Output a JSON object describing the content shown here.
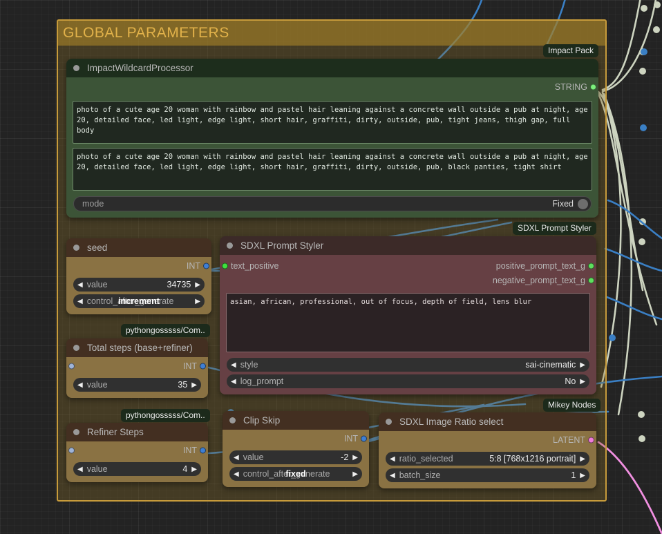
{
  "group": {
    "title": "GLOBAL PARAMETERS",
    "border_color": "#c79b3b",
    "title_color": "#e2b24a"
  },
  "badges": {
    "impact_pack": "Impact Pack",
    "sdxl_prompt_styler": "SDXL Prompt Styler",
    "pythongosssss_1": "pythongosssss/Com..",
    "pythongosssss_2": "pythongosssss/Com..",
    "mikey_nodes": "Mikey Nodes"
  },
  "nodes": {
    "wildcard": {
      "title": "ImpactWildcardProcessor",
      "output_label": "STRING",
      "output_color": "#7cf07c",
      "textarea_1": "photo of a cute age 20 woman with rainbow and pastel hair leaning against a concrete wall outside a pub at night, age 20, detailed face, led light, edge light, short hair, graffiti, dirty, outside, pub, tight jeans, thigh gap, full body",
      "textarea_2": "photo of a cute age 20 woman with rainbow and pastel hair leaning against a concrete wall outside a pub at night, age 20, detailed face, led light, edge light, short hair, graffiti, dirty, outside, pub, black panties, tight shirt",
      "mode_label": "mode",
      "mode_value": "Fixed"
    },
    "seed": {
      "title": "seed",
      "output_label": "INT",
      "output_color": "#3f7fd4",
      "widgets": [
        {
          "label": "value",
          "value": "34735",
          "overlap": false
        },
        {
          "label": "control_after_generate",
          "value": "increment",
          "overlap": true
        }
      ]
    },
    "total_steps": {
      "title": "Total steps (base+refiner)",
      "output_label": "INT",
      "output_color": "#3f7fd4",
      "input_color": "#9fb4d8",
      "widgets": [
        {
          "label": "value",
          "value": "35",
          "overlap": false
        }
      ]
    },
    "refiner_steps": {
      "title": "Refiner Steps",
      "output_label": "INT",
      "output_color": "#3f7fd4",
      "input_color": "#9fb4d8",
      "widgets": [
        {
          "label": "value",
          "value": "4",
          "overlap": false
        }
      ]
    },
    "styler": {
      "title": "SDXL Prompt Styler",
      "input_label": "text_positive",
      "input_color": "#3ee03e",
      "output_1_label": "positive_prompt_text_g",
      "output_2_label": "negative_prompt_text_g",
      "output_color": "#5ee05e",
      "textarea": "asian, african, professional, out of focus, depth of field, lens blur",
      "widgets": [
        {
          "label": "style",
          "value": "sai-cinematic"
        },
        {
          "label": "log_prompt",
          "value": "No"
        }
      ]
    },
    "clip_skip": {
      "title": "Clip Skip",
      "output_label": "INT",
      "output_color": "#3f7fd4",
      "input_color": "#9fb4d8",
      "widgets": [
        {
          "label": "value",
          "value": "-2",
          "overlap": false
        },
        {
          "label": "control_after_generate",
          "value": "fixed",
          "overlap": true
        }
      ]
    },
    "ratio": {
      "title": "SDXL Image Ratio select",
      "output_label": "LATENT",
      "output_color": "#ef7cd8",
      "widgets": [
        {
          "label": "ratio_selected",
          "value": "5:8 [768x1216 portrait]"
        },
        {
          "label": "batch_size",
          "value": "1"
        }
      ]
    }
  },
  "link_colors": {
    "int": "#3a7fc4",
    "string": "#cdd4c0",
    "latent": "#f08fe0"
  }
}
